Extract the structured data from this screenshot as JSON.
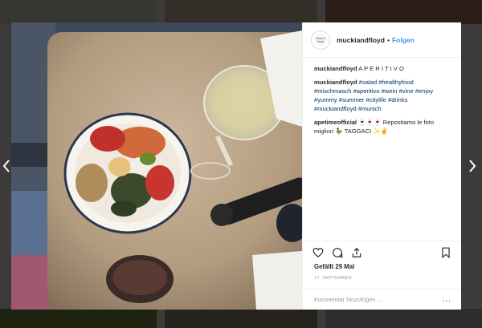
{
  "post": {
    "username": "muckiandfloyd",
    "separator": "•",
    "follow_label": "Folgen",
    "avatar_text": "muck & floyd"
  },
  "comments": [
    {
      "user": "muckiandfloyd",
      "text": "A P E R I T I V O"
    },
    {
      "user": "muckiandfloyd",
      "tags_line1": "#salad #healthyfood",
      "tags_line2": "#mischmasch #aperitivo #wein #vine #enjoy",
      "tags_line3": "#yummy #summer #citylife #drinks",
      "tags_line4": "#muckiandfloyd #munich"
    },
    {
      "user": "apetimeofficial",
      "text_line1": "🍷🍷🍷 Repostiamo le foto",
      "text_line2": "migliori 🦆 TAGGACI ✨✌"
    }
  ],
  "likes": "Gefällt 29 Mal",
  "date": "17. SEPTEMBER",
  "comment_input": {
    "placeholder": "Kommentar hinzufügen ..."
  },
  "more_label": "...",
  "icons": [
    "heart-icon",
    "comment-icon",
    "share-icon",
    "bookmark-icon",
    "chevron-left-icon",
    "chevron-right-icon"
  ],
  "colors": {
    "link": "#3897f0",
    "hashtag": "#003569",
    "text": "#262626",
    "muted": "#999999"
  }
}
